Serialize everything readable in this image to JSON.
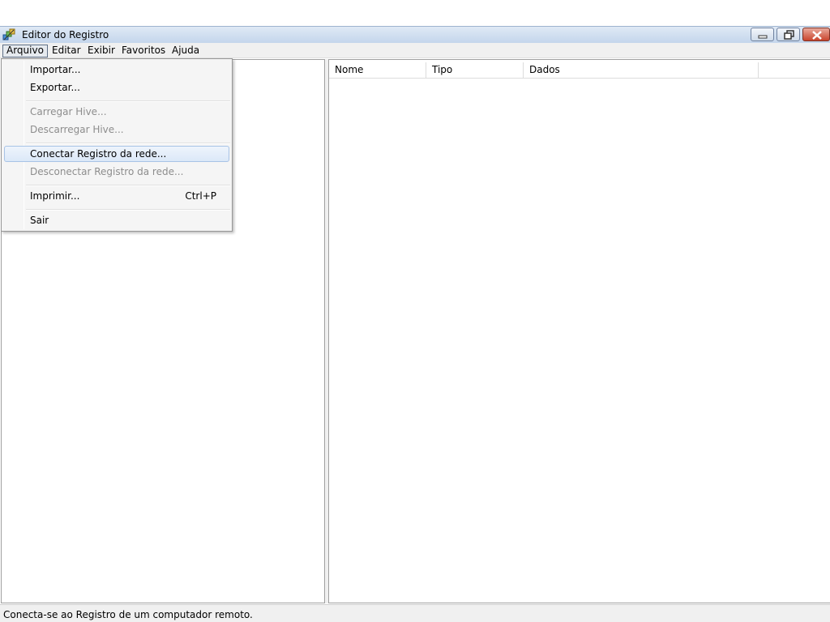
{
  "window": {
    "title": "Editor do Registro",
    "app_icon": "registry-editor-icon",
    "controls": [
      "minimize-icon",
      "restore-icon",
      "close-icon"
    ]
  },
  "menubar": {
    "items": [
      {
        "label": "Arquivo",
        "active": true
      },
      {
        "label": "Editar"
      },
      {
        "label": "Exibir"
      },
      {
        "label": "Favoritos"
      },
      {
        "label": "Ajuda"
      }
    ]
  },
  "file_menu": {
    "items": [
      {
        "label": "Importar...",
        "enabled": true
      },
      {
        "label": "Exportar...",
        "enabled": true
      },
      {
        "label": "Carregar Hive...",
        "enabled": false
      },
      {
        "label": "Descarregar Hive...",
        "enabled": false
      },
      {
        "label": "Conectar Registro da rede...",
        "enabled": true,
        "highlighted": true
      },
      {
        "label": "Desconectar Registro da rede...",
        "enabled": false
      },
      {
        "label": "Imprimir...",
        "enabled": true,
        "shortcut": "Ctrl+P"
      },
      {
        "label": "Sair",
        "enabled": true
      }
    ]
  },
  "list_view": {
    "columns": [
      "Nome",
      "Tipo",
      "Dados"
    ]
  },
  "status_bar": {
    "text": "Conecta-se ao Registro de um computador remoto."
  },
  "colors": {
    "title_bar": "#c4d6ec",
    "menu_highlight": "#dbe8f8",
    "close_button": "#c9442d"
  }
}
